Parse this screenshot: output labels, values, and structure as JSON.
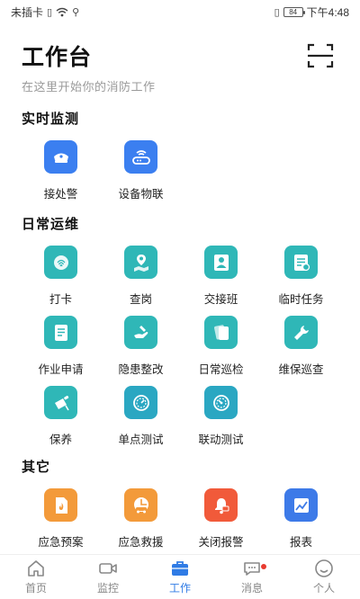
{
  "status_bar": {
    "carrier": "未插卡",
    "battery": "84",
    "time": "下午4:48"
  },
  "header": {
    "title": "工作台",
    "subtitle": "在这里开始你的消防工作"
  },
  "sections": {
    "realtime": {
      "title": "实时监测",
      "items": [
        {
          "label": "接处警",
          "icon": "police-hat-icon",
          "color": "#3b7ff0"
        },
        {
          "label": "设备物联",
          "icon": "router-icon",
          "color": "#3b7ff0"
        }
      ]
    },
    "daily": {
      "title": "日常运维",
      "items": [
        {
          "label": "打卡",
          "icon": "fingerprint-icon",
          "color": "#2fb7b7"
        },
        {
          "label": "查岗",
          "icon": "map-pin-icon",
          "color": "#2fb7b7"
        },
        {
          "label": "交接班",
          "icon": "user-handover-icon",
          "color": "#2fb7b7"
        },
        {
          "label": "临时任务",
          "icon": "task-list-icon",
          "color": "#2fb7b7"
        },
        {
          "label": "作业申请",
          "icon": "application-form-icon",
          "color": "#2fb7b7"
        },
        {
          "label": "隐患整改",
          "icon": "hand-repair-icon",
          "color": "#2fb7b7"
        },
        {
          "label": "日常巡检",
          "icon": "inspection-card-icon",
          "color": "#2fb7b7"
        },
        {
          "label": "维保巡查",
          "icon": "wrench-icon",
          "color": "#2fb7b7"
        },
        {
          "label": "保养",
          "icon": "extinguisher-icon",
          "color": "#2fb7b7"
        },
        {
          "label": "单点测试",
          "icon": "gauge-icon",
          "color": "#2aa7c2"
        },
        {
          "label": "联动测试",
          "icon": "gauge-linked-icon",
          "color": "#2aa7c2"
        }
      ]
    },
    "other": {
      "title": "其它",
      "items": [
        {
          "label": "应急预案",
          "icon": "fire-document-icon",
          "color": "#f39a3a"
        },
        {
          "label": "应急救援",
          "icon": "rescue-vehicle-icon",
          "color": "#f39a3a"
        },
        {
          "label": "关闭报警",
          "icon": "alarm-bell-off-icon",
          "color": "#f15a3a"
        },
        {
          "label": "报表",
          "icon": "report-chart-icon",
          "color": "#3d7ae8"
        }
      ]
    }
  },
  "tabbar": {
    "items": [
      {
        "label": "首页",
        "icon": "home-icon"
      },
      {
        "label": "监控",
        "icon": "video-camera-icon"
      },
      {
        "label": "工作",
        "icon": "briefcase-icon",
        "active": true
      },
      {
        "label": "消息",
        "icon": "chat-bubble-icon",
        "badge": true
      },
      {
        "label": "个人",
        "icon": "person-icon"
      }
    ]
  },
  "colors": {
    "accent": "#2f7be5",
    "teal": "#2fb7b7",
    "orange": "#f39a3a",
    "red": "#f15a3a"
  }
}
